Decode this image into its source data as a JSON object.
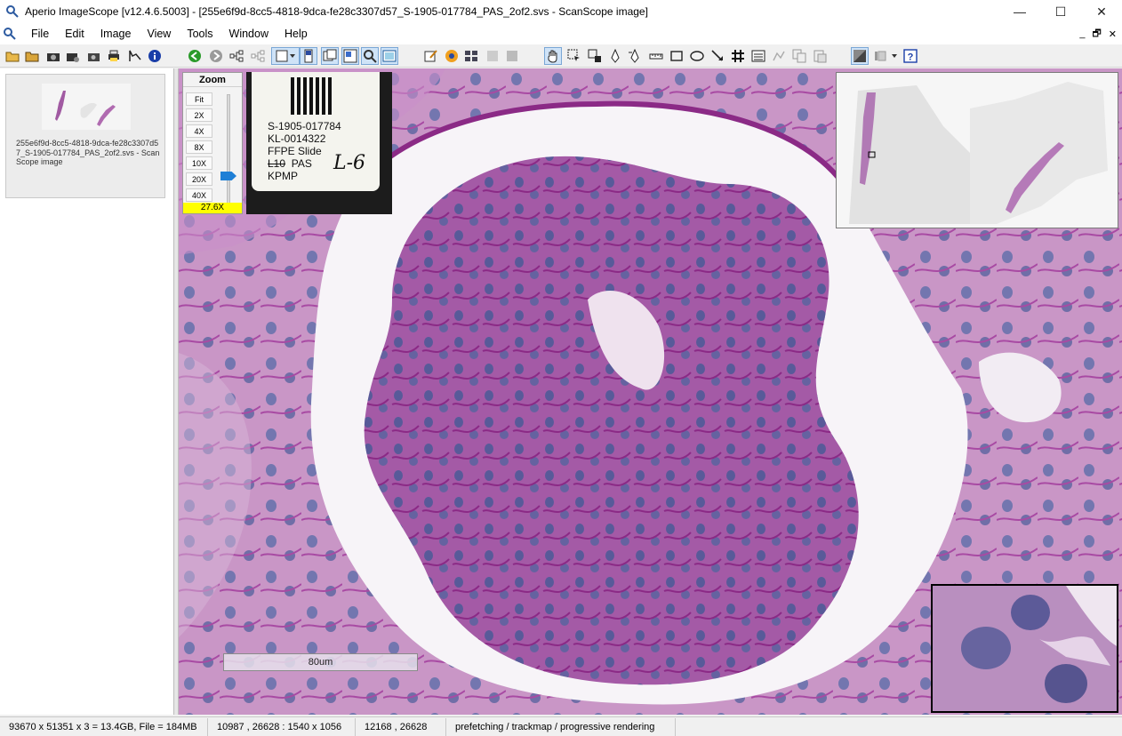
{
  "window": {
    "title": "Aperio ImageScope [v12.4.6.5003] - [255e6f9d-8cc5-4818-9dca-fe28c3307d57_S-1905-017784_PAS_2of2.svs - ScanScope image]",
    "minimize": "—",
    "maximize": "☐",
    "close": "✕"
  },
  "menu": {
    "items": [
      "File",
      "Edit",
      "Image",
      "View",
      "Tools",
      "Window",
      "Help"
    ],
    "mdi_minimize": "_",
    "mdi_restore": "🗗",
    "mdi_close": "✕"
  },
  "toolbar": {
    "icons": [
      "open-folder-icon",
      "open-folder-alt-icon",
      "camera-icon",
      "camera-settings-icon",
      "camera-export-icon",
      "printer-icon",
      "graph-icon",
      "info-icon",
      "back-icon",
      "forward-icon",
      "hierarchy-icon",
      "hierarchy-alt-icon",
      "display-dropdown-icon",
      "slide-label-icon",
      "overview-icon",
      "thumbnail-icon",
      "magnifier-icon",
      "panel-icon",
      "edit-icon",
      "link-icon",
      "compare-icon",
      "sync-icon",
      "sync-alt-icon",
      "pan-tool-icon",
      "select-tool-icon",
      "zoom-select-icon",
      "pen-tool-icon",
      "negative-pen-icon",
      "ruler-icon",
      "rectangle-tool-icon",
      "ellipse-tool-icon",
      "arrow-tool-icon",
      "grid-icon",
      "annotation-list-icon",
      "analysis-icon",
      "copy-icon",
      "paste-icon",
      "image-adjust-icon",
      "color-adjust-icon",
      "help-icon"
    ],
    "active": [
      "slide-label-icon",
      "thumbnail-icon",
      "magnifier-icon",
      "pan-tool-icon",
      "image-adjust-icon"
    ]
  },
  "left_panel": {
    "thumbnail_caption": "255e6f9d-8cc5-4818-9dca-fe28c3307d57_S-1905-017784_PAS_2of2.svs - ScanScope image"
  },
  "zoom": {
    "title": "Zoom",
    "buttons": [
      "Fit",
      "2X",
      "4X",
      "8X",
      "10X",
      "20X",
      "40X"
    ],
    "current": "27.6X"
  },
  "slide_label": {
    "lines": [
      "S-1905-017784",
      "KL-0014322",
      "FFPE Slide"
    ],
    "strike": "L10",
    "stain": "PAS",
    "project": "KPMP",
    "handwritten": "L-6"
  },
  "scale_bar": {
    "label": "80um"
  },
  "status": {
    "dimensions": "93670 x 51351 x 3 = 13.4GB, File = 184MB",
    "region": "10987 , 26628 : 1540 x 1056",
    "cursor": "12168 , 26628",
    "mode": "prefetching / trackmap / progressive rendering"
  },
  "colors": {
    "tissue_bg": "#c996c6",
    "stroma": "#8b2a86",
    "nuclei": "#4b5a96",
    "lumen": "#f7f4f8",
    "zoom_indicator": "#ffff00",
    "zoom_thumb": "#1f7fd6"
  }
}
